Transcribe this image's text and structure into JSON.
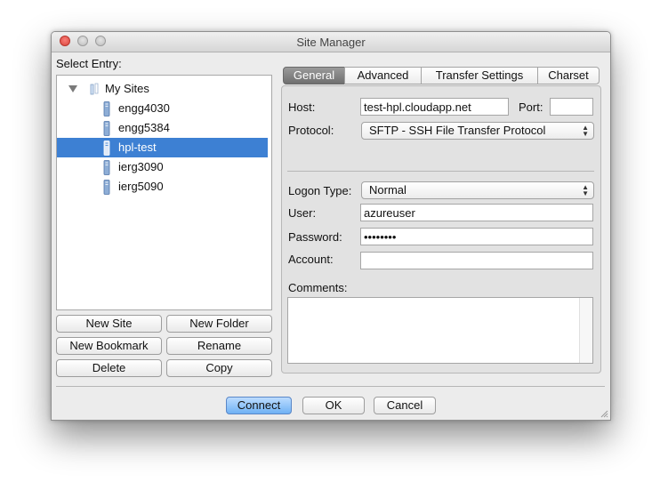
{
  "window": {
    "title": "Site Manager"
  },
  "left": {
    "select_label": "Select Entry:",
    "root": "My Sites",
    "sites": [
      "engg4030",
      "engg5384",
      "hpl-test",
      "ierg3090",
      "ierg5090"
    ],
    "selected": "hpl-test"
  },
  "buttons": {
    "new_site": "New Site",
    "new_folder": "New Folder",
    "new_bookmark": "New Bookmark",
    "rename": "Rename",
    "delete": "Delete",
    "copy": "Copy",
    "connect": "Connect",
    "ok": "OK",
    "cancel": "Cancel"
  },
  "tabs": [
    "General",
    "Advanced",
    "Transfer Settings",
    "Charset"
  ],
  "general": {
    "host_label": "Host:",
    "host_value": "test-hpl.cloudapp.net",
    "port_label": "Port:",
    "port_value": "",
    "protocol_label": "Protocol:",
    "protocol_value": "SFTP - SSH File Transfer Protocol",
    "logon_label": "Logon Type:",
    "logon_value": "Normal",
    "user_label": "User:",
    "user_value": "azureuser",
    "password_label": "Password:",
    "password_value": "••••••••",
    "account_label": "Account:",
    "account_value": "",
    "comments_label": "Comments:"
  },
  "colors": {
    "selection": "#3d80d3",
    "default_button": "#6fb1f4",
    "close": "#d9453c"
  }
}
